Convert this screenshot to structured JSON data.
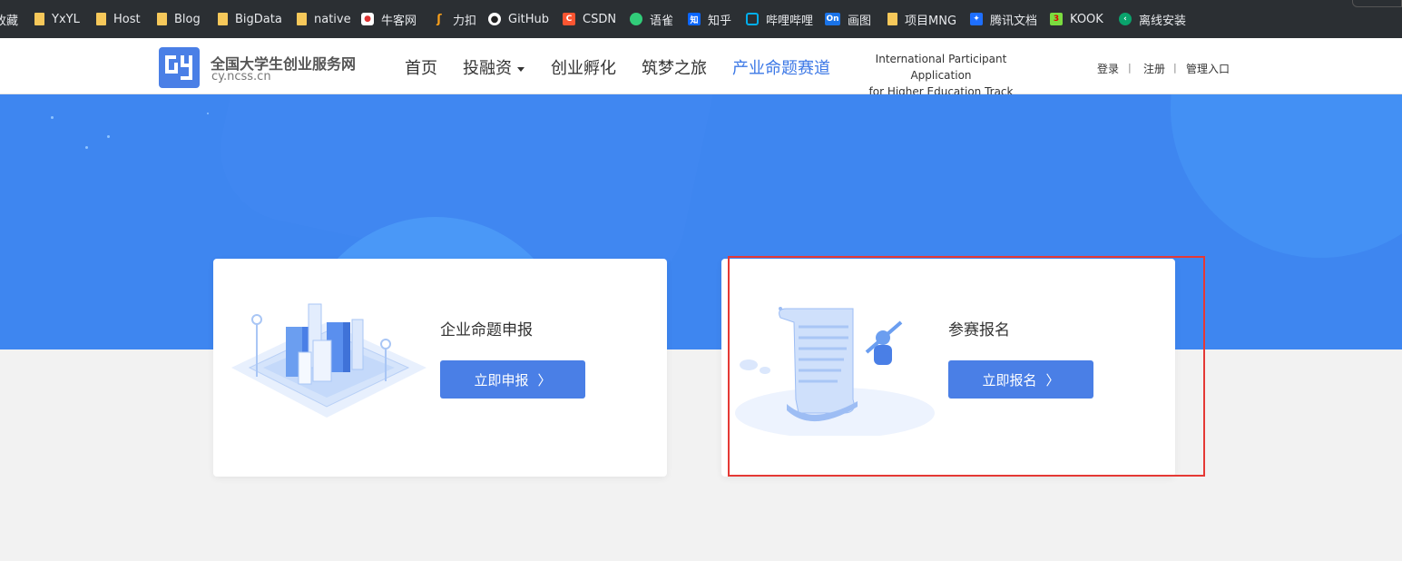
{
  "bookmarks": [
    {
      "label": "收藏",
      "icon": "none"
    },
    {
      "label": "YxYL",
      "icon": "folder-icon"
    },
    {
      "label": "Host",
      "icon": "folder-icon"
    },
    {
      "label": "Blog",
      "icon": "folder-icon"
    },
    {
      "label": "BigData",
      "icon": "folder-icon"
    },
    {
      "label": "native",
      "icon": "folder-icon"
    },
    {
      "label": "牛客网",
      "icon": "nowcoder-icon"
    },
    {
      "label": "力扣",
      "icon": "leetcode-icon"
    },
    {
      "label": "GitHub",
      "icon": "github-icon"
    },
    {
      "label": "CSDN",
      "icon": "csdn-icon"
    },
    {
      "label": "语雀",
      "icon": "yuque-icon"
    },
    {
      "label": "知乎",
      "icon": "zhihu-icon"
    },
    {
      "label": "哔哩哔哩",
      "icon": "bilibili-icon"
    },
    {
      "label": "画图",
      "icon": "processon-icon"
    },
    {
      "label": "项目MNG",
      "icon": "folder-icon"
    },
    {
      "label": "腾讯文档",
      "icon": "tencent-docs-icon"
    },
    {
      "label": "KOOK",
      "icon": "kook-icon"
    },
    {
      "label": "离线安装",
      "icon": "offline-install-icon"
    }
  ],
  "header": {
    "site_title": "全国大学生创业服务网",
    "site_domain": "cy.ncss.cn",
    "logo_text": "CY",
    "nav": [
      {
        "label": "首页",
        "active": false
      },
      {
        "label": "投融资",
        "active": false,
        "has_dropdown": true
      },
      {
        "label": "创业孵化",
        "active": false
      },
      {
        "label": "筑梦之旅",
        "active": false
      },
      {
        "label": "产业命题赛道",
        "active": true
      }
    ],
    "intl_line1": "International Participant Application",
    "intl_line2": "for Higher Education Track",
    "login": "登录",
    "register": "注册",
    "admin": "管理入口",
    "separator": "|"
  },
  "cards": [
    {
      "title": "企业命题申报",
      "button": "立即申报",
      "chevron": "〉",
      "illustration": "city-buildings-icon"
    },
    {
      "title": "参赛报名",
      "button": "立即报名",
      "chevron": "〉",
      "illustration": "scroll-registration-icon"
    }
  ],
  "colors": {
    "primary": "#4a7fe6",
    "hero": "#3e86f0",
    "nav_active": "#3c78e6",
    "highlight": "#e53935"
  }
}
